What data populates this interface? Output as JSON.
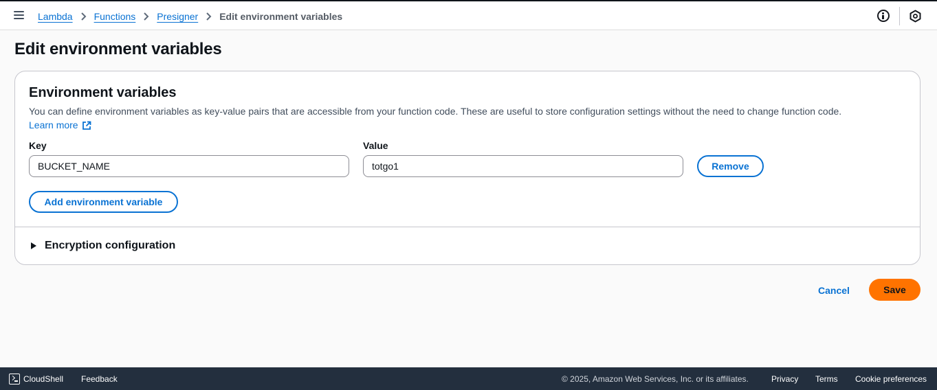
{
  "breadcrumb": {
    "items": [
      "Lambda",
      "Functions",
      "Presigner"
    ],
    "current": "Edit environment variables"
  },
  "page": {
    "title": "Edit environment variables"
  },
  "env_panel": {
    "title": "Environment variables",
    "description": "You can define environment variables as key-value pairs that are accessible from your function code. These are useful to store configuration settings without the need to change function code.",
    "learn_more": "Learn more",
    "key_label": "Key",
    "value_label": "Value",
    "variables": [
      {
        "key": "BUCKET_NAME",
        "value": "totgo1",
        "remove_label": "Remove"
      }
    ],
    "add_label": "Add environment variable",
    "encryption_label": "Encryption configuration"
  },
  "actions": {
    "cancel": "Cancel",
    "save": "Save"
  },
  "footer": {
    "cloudshell": "CloudShell",
    "feedback": "Feedback",
    "copyright": "© 2025, Amazon Web Services, Inc. or its affiliates.",
    "privacy": "Privacy",
    "terms": "Terms",
    "cookies": "Cookie preferences"
  },
  "icons": {
    "menu": "hamburger-icon",
    "info": "info-icon",
    "profile": "hexagon-icon",
    "external": "external-link-icon",
    "cloudshell": "terminal-icon"
  },
  "colors": {
    "link": "#0972d3",
    "primary_button": "#ff7300",
    "footer_bg": "#232f3e"
  }
}
